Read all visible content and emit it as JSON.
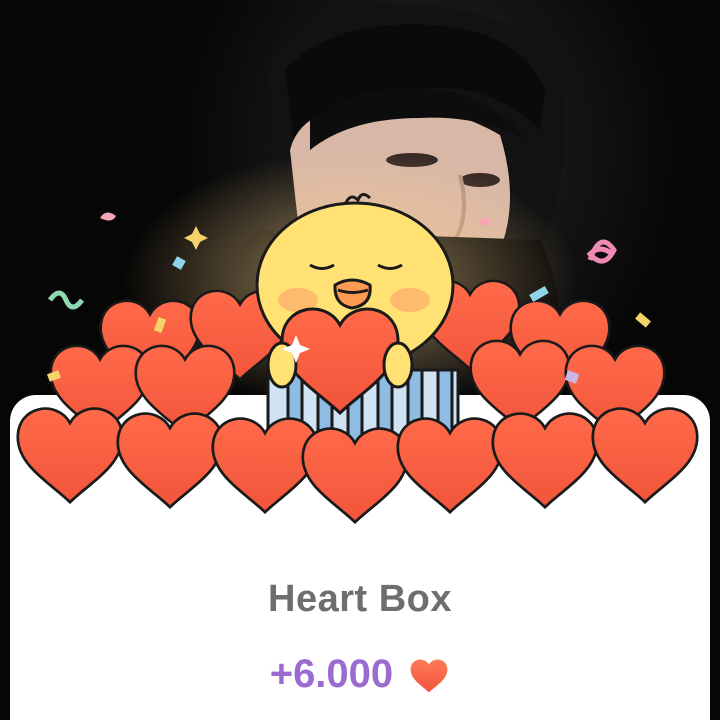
{
  "popup": {
    "title": "Heart Box",
    "reward_amount": "+6.000",
    "reward_icon": "heart-icon"
  },
  "colors": {
    "title": "#6e6e6e",
    "reward": "#9a6bd1",
    "heart": "#f2553a",
    "chick": "#ffe174"
  }
}
